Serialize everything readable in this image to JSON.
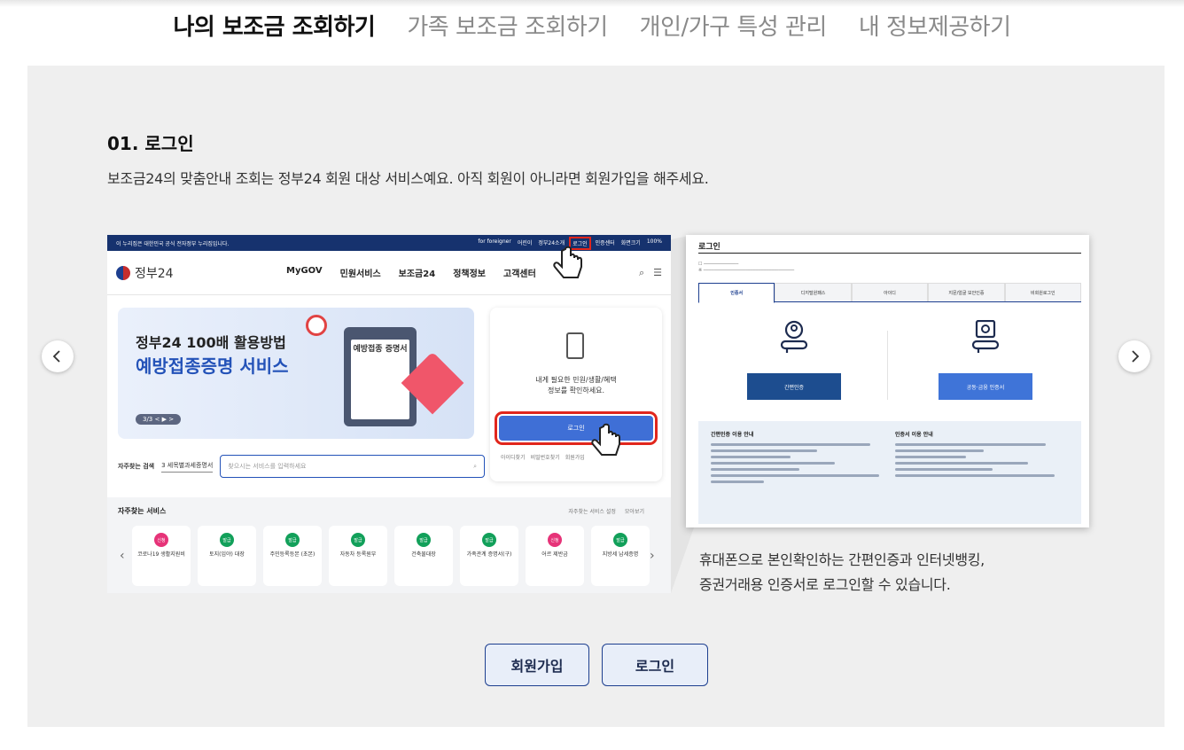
{
  "tabs": [
    {
      "label": "나의 보조금 조회하기",
      "active": true
    },
    {
      "label": "가족 보조금 조회하기",
      "active": false
    },
    {
      "label": "개인/가구 특성 관리",
      "active": false
    },
    {
      "label": "내 정보제공하기",
      "active": false
    }
  ],
  "step": {
    "title": "01. 로그인",
    "description": "보조금24의 맞춤안내 조회는 정부24 회원 대상 서비스예요. 아직 회원이 아니라면 회원가입을 해주세요."
  },
  "carousel": {
    "prev_icon": "chevron-left-icon",
    "next_icon": "chevron-right-icon"
  },
  "shot_home": {
    "topbar_left": "이 누리집은 대한민국 공식 전자정부 누리집입니다.",
    "topbar_items": [
      "for foreigner",
      "어린이",
      "정부24소개",
      "로그인",
      "인증센터",
      "화면크기",
      "100%"
    ],
    "logo": "정부24",
    "menu": [
      "MyGOV",
      "민원서비스",
      "보조금24",
      "정책정보",
      "고객센터"
    ],
    "banner_line1": "정부24 100배 활용방법",
    "banner_line2": "예방접종증명 서비스",
    "banner_paper": "예방접종 증명서",
    "banner_pager": "3/3 < ▶ >",
    "card_text_1": "내게 필요한 민원/생활/혜택",
    "card_text_2": "정보를 확인하세요.",
    "card_button": "로그인",
    "card_links": [
      "아이디찾기",
      "비밀번호찾기",
      "회원가입"
    ],
    "search_label": "자주찾는 검색",
    "search_select": "3 세목별과세증명서",
    "search_placeholder": "찾으시는 서비스를 입력하세요",
    "services_title": "자주찾는 서비스",
    "services_links": [
      "자주찾는 서비스 설정",
      "모아보기"
    ],
    "services": [
      {
        "badge": "신청",
        "label": "코로나19 생활지원비",
        "pink": true
      },
      {
        "badge": "발급",
        "label": "토지(임야) 대장",
        "pink": false
      },
      {
        "badge": "발급",
        "label": "주민등록등본 (초본)",
        "pink": false
      },
      {
        "badge": "발급",
        "label": "자동차 등록원부",
        "pink": false
      },
      {
        "badge": "발급",
        "label": "건축물대장",
        "pink": false
      },
      {
        "badge": "발급",
        "label": "가족관계 증명서(구)",
        "pink": false
      },
      {
        "badge": "신청",
        "label": "어르 제반금",
        "pink": true
      },
      {
        "badge": "발급",
        "label": "지방세 납세증명",
        "pink": false
      }
    ]
  },
  "shot_login": {
    "title": "로그인",
    "tabs": [
      "인증서",
      "디지털원패스",
      "아이디",
      "지문/얼굴 보안인증",
      "비회원로그인"
    ],
    "btn_simple": "간편인증",
    "btn_joint": "공동·금융 인증서",
    "info_simple": "간편인증 이용 안내",
    "info_cert": "인증서 이용 안내"
  },
  "caption": {
    "line1": "휴대폰으로 본인확인하는 간편인증과 인터넷뱅킹,",
    "line2": "증권거래용 인증서로 로그인할 수 있습니다."
  },
  "actions": {
    "signup": "회원가입",
    "login": "로그인"
  },
  "colors": {
    "navy": "#16326e",
    "blue": "#2352b8",
    "highlight": "#e1261c",
    "panel": "#efefef"
  }
}
